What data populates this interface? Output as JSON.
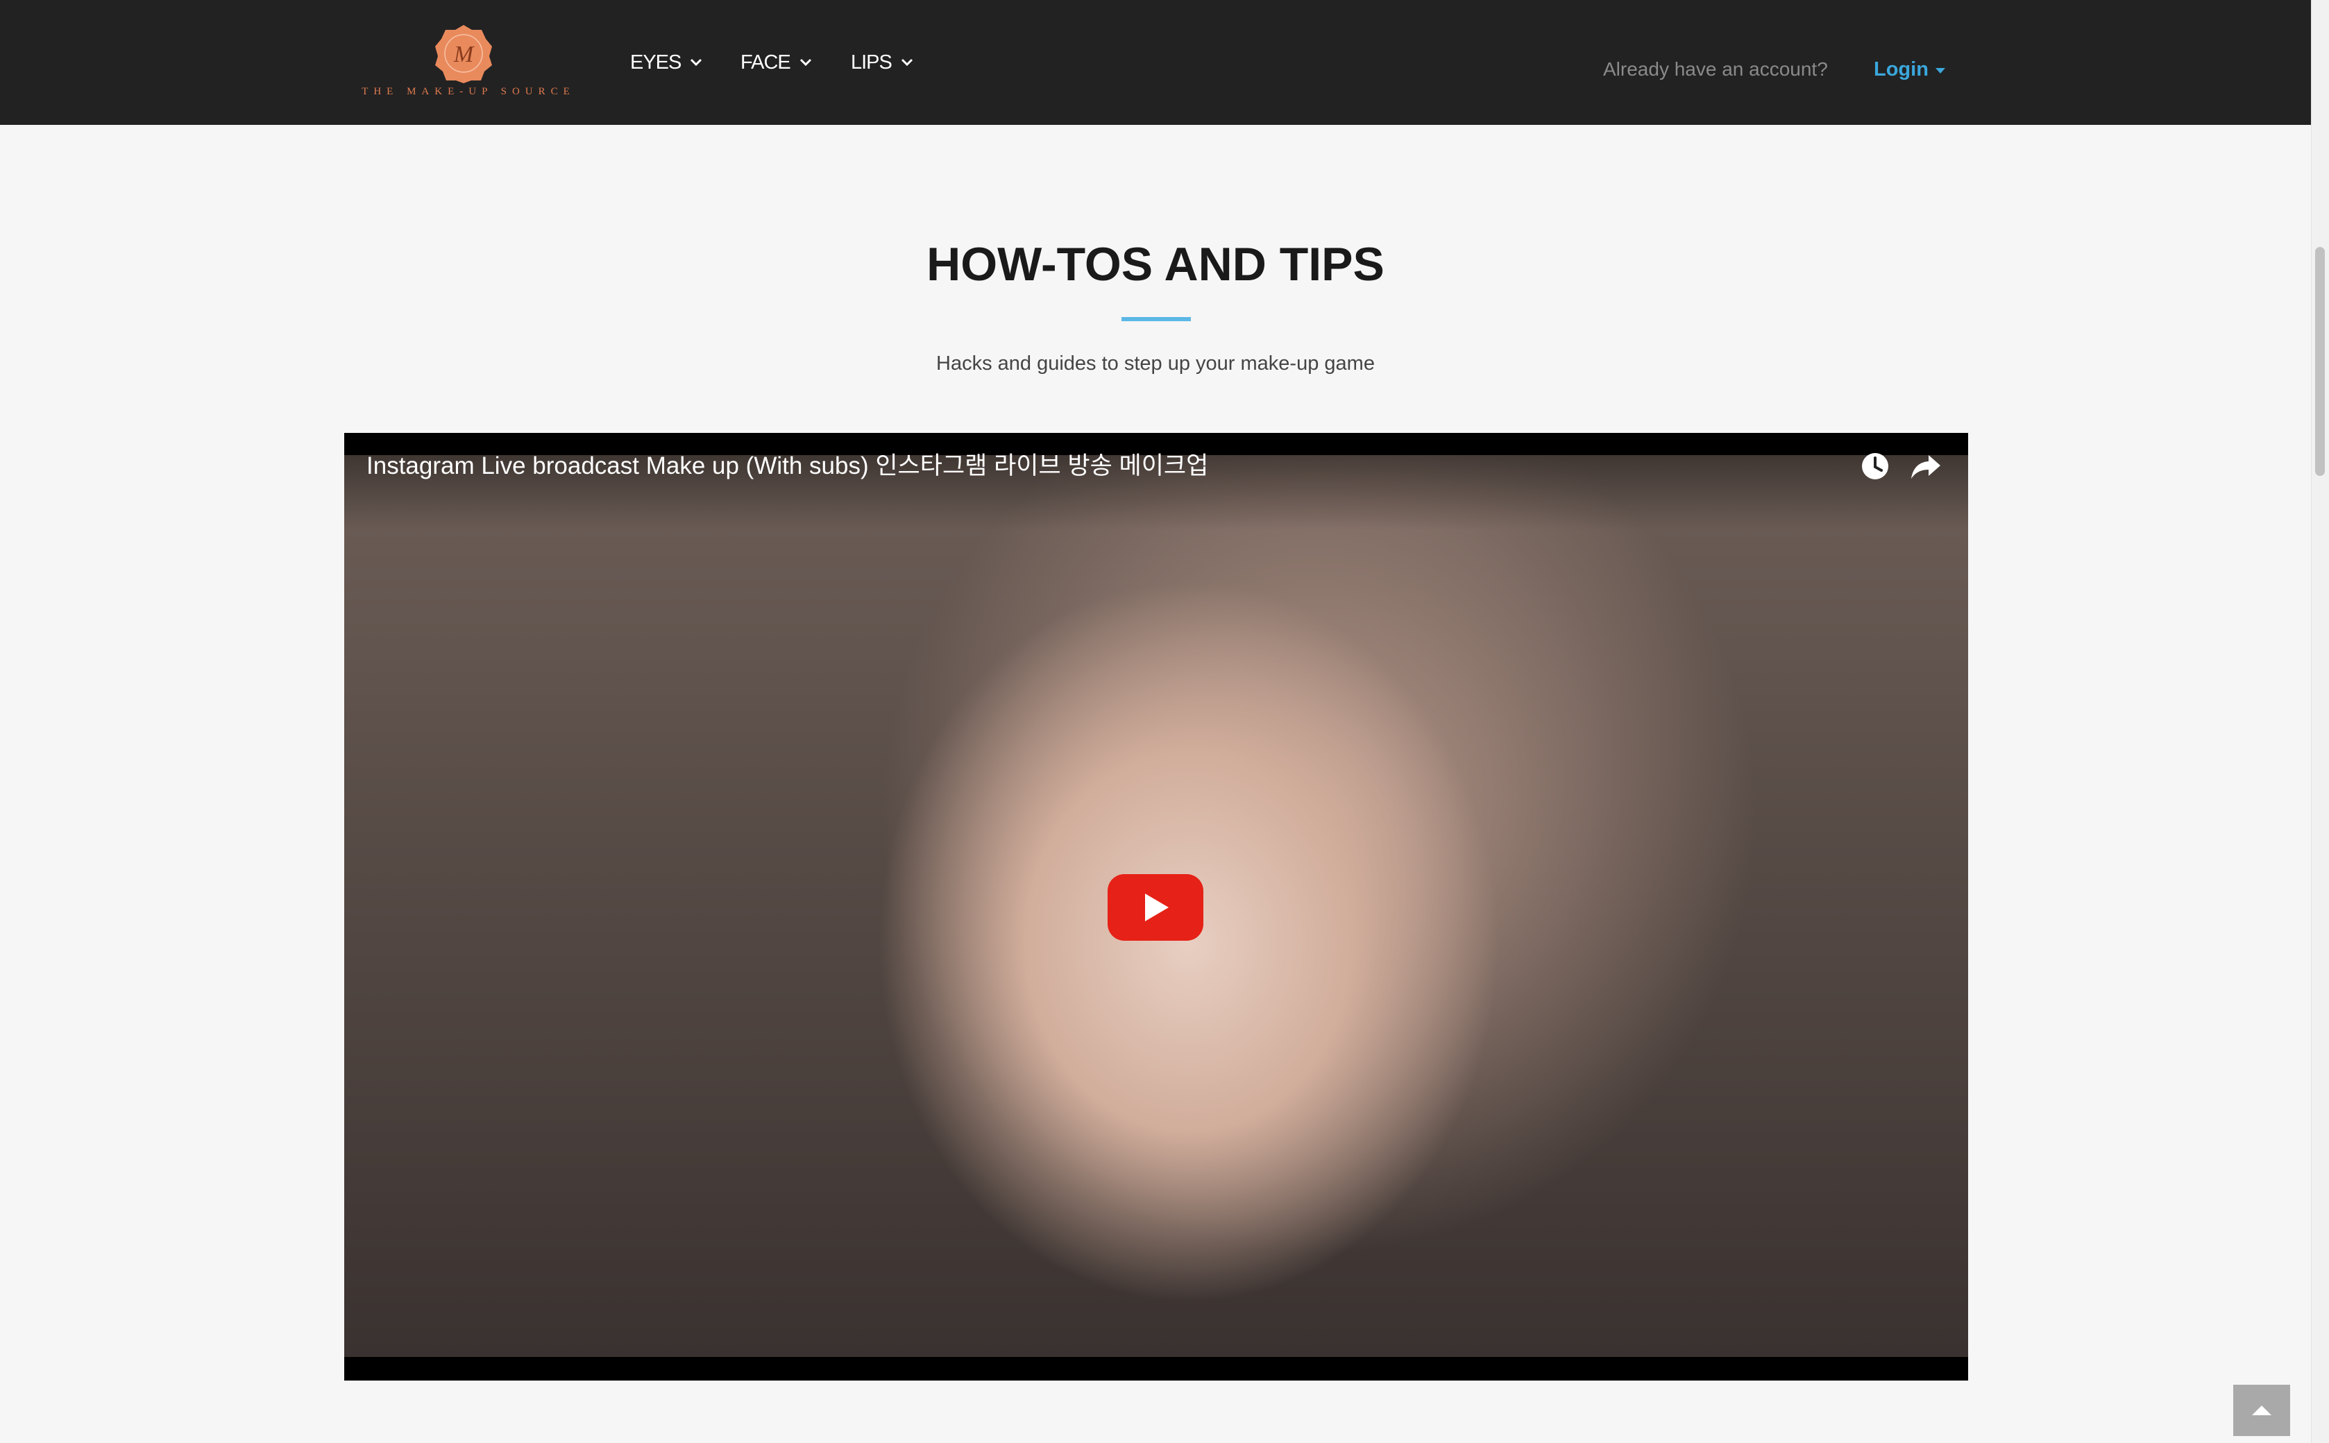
{
  "header": {
    "logo": {
      "monogram": "M",
      "text": "THE MAKE-UP SOURCE",
      "badge_color": "#e98a5d"
    },
    "nav": [
      {
        "label": "EYES",
        "icon": "chevron-down-icon"
      },
      {
        "label": "FACE",
        "icon": "chevron-down-icon"
      },
      {
        "label": "LIPS",
        "icon": "chevron-down-icon"
      }
    ],
    "account_prompt": "Already have an account?",
    "login_label": "Login",
    "accent_color": "#3ba7dc"
  },
  "section": {
    "title": "HOW-TOS AND TIPS",
    "subtitle": "Hacks and guides to step up your make-up game",
    "rule_color": "#5bb8e6"
  },
  "video": {
    "title": "Instagram Live broadcast Make up (With subs) 인스타그램 라이브 방송 메이크업",
    "icons": [
      "watch-later-icon",
      "share-icon",
      "play-icon"
    ],
    "play_button_color": "#e62117"
  },
  "back_to_top": {
    "icon": "chevron-up-icon"
  }
}
